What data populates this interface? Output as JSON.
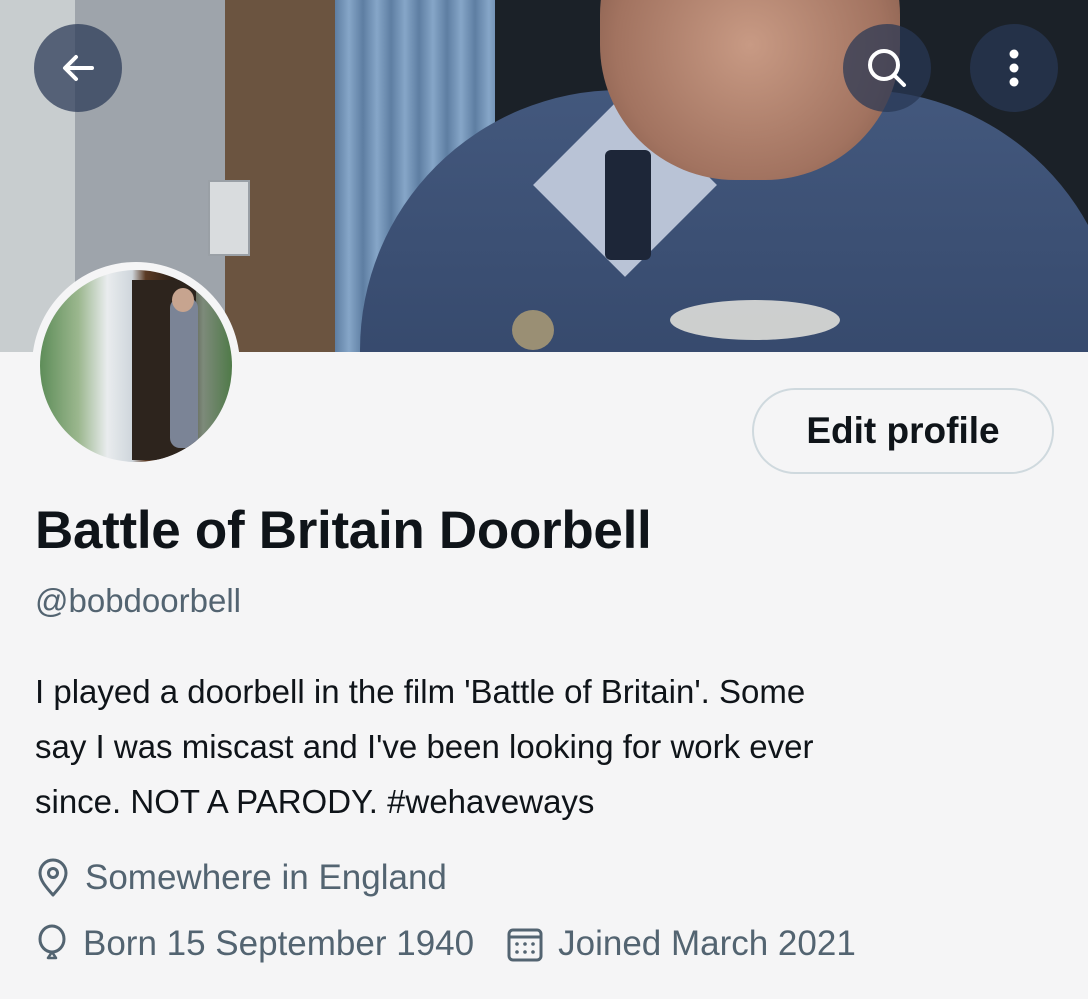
{
  "header": {
    "back_icon": "arrow-left-icon",
    "search_icon": "search-icon",
    "more_icon": "more-vertical-icon"
  },
  "profile": {
    "edit_button": "Edit profile",
    "display_name": "Battle of Britain Doorbell",
    "handle": "@bobdoorbell",
    "bio_lines": [
      "I played a doorbell in the film 'Battle of Britain'. Some",
      "say I was miscast and I've been looking for work ever"
    ],
    "bio_line3_text": "since. NOT A PARODY. ",
    "bio_hashtag": "#wehaveways",
    "location": "Somewhere in England",
    "birth": "Born 15 September 1940",
    "joined": "Joined March 2021"
  },
  "colors": {
    "background": "#f5f5f6",
    "text_primary": "#0f1419",
    "text_secondary": "#536471",
    "button_border": "#cfd9de",
    "overlay_button": "#283755"
  }
}
